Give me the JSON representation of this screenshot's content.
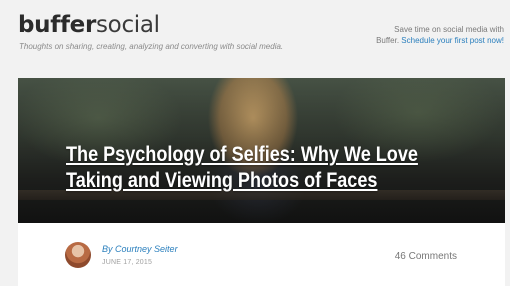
{
  "header": {
    "logo_bold": "buffer",
    "logo_light": "social",
    "tagline": "Thoughts on sharing, creating, analyzing and converting with social media.",
    "promo_line1": "Save time on social media with",
    "promo_prefix": "Buffer.",
    "promo_link": "Schedule your first post now!"
  },
  "hero": {
    "title": "The Psychology of Selfies: Why We Love Taking and Viewing Photos of Faces"
  },
  "author": {
    "byline_prefix": "By",
    "name": "Courtney Seiter",
    "date": "JUNE 17, 2015"
  },
  "comments": {
    "label": "46 Comments"
  },
  "colors": {
    "link": "#2a7fbd",
    "background": "#f2f2f2"
  }
}
